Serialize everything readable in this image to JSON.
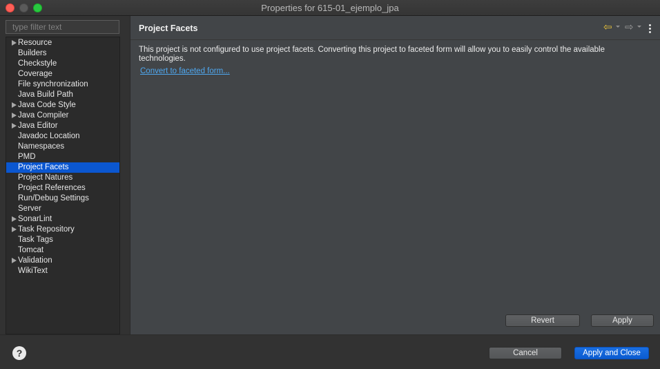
{
  "window": {
    "title": "Properties for 615-01_ejemplo_jpa"
  },
  "sidebar": {
    "filter_placeholder": "type filter text",
    "items": [
      {
        "label": "Resource",
        "expandable": true
      },
      {
        "label": "Builders",
        "expandable": false
      },
      {
        "label": "Checkstyle",
        "expandable": false
      },
      {
        "label": "Coverage",
        "expandable": false
      },
      {
        "label": "File synchronization",
        "expandable": false
      },
      {
        "label": "Java Build Path",
        "expandable": false
      },
      {
        "label": "Java Code Style",
        "expandable": true
      },
      {
        "label": "Java Compiler",
        "expandable": true
      },
      {
        "label": "Java Editor",
        "expandable": true
      },
      {
        "label": "Javadoc Location",
        "expandable": false
      },
      {
        "label": "Namespaces",
        "expandable": false
      },
      {
        "label": "PMD",
        "expandable": false
      },
      {
        "label": "Project Facets",
        "expandable": false,
        "selected": true
      },
      {
        "label": "Project Natures",
        "expandable": false
      },
      {
        "label": "Project References",
        "expandable": false
      },
      {
        "label": "Run/Debug Settings",
        "expandable": false
      },
      {
        "label": "Server",
        "expandable": false
      },
      {
        "label": "SonarLint",
        "expandable": true
      },
      {
        "label": "Task Repository",
        "expandable": true
      },
      {
        "label": "Task Tags",
        "expandable": false
      },
      {
        "label": "Tomcat",
        "expandable": false
      },
      {
        "label": "Validation",
        "expandable": true
      },
      {
        "label": "WikiText",
        "expandable": false
      }
    ]
  },
  "page": {
    "title": "Project Facets",
    "description": "This project is not configured to use project facets. Converting this project to faceted form will allow you to easily control the available technologies.",
    "convert_link": "Convert to faceted form...",
    "revert_label": "Revert",
    "apply_label": "Apply",
    "nav": {
      "back_icon": "arrow-left-icon",
      "forward_icon": "arrow-right-icon",
      "menu_icon": "kebab-menu-icon"
    }
  },
  "footer": {
    "help_icon": "?",
    "cancel_label": "Cancel",
    "apply_close_label": "Apply and Close"
  },
  "colors": {
    "selection": "#0b57d0",
    "link": "#4fa8f0",
    "back_arrow": "#e8c23a",
    "primary_button": "#1a6fe2"
  }
}
